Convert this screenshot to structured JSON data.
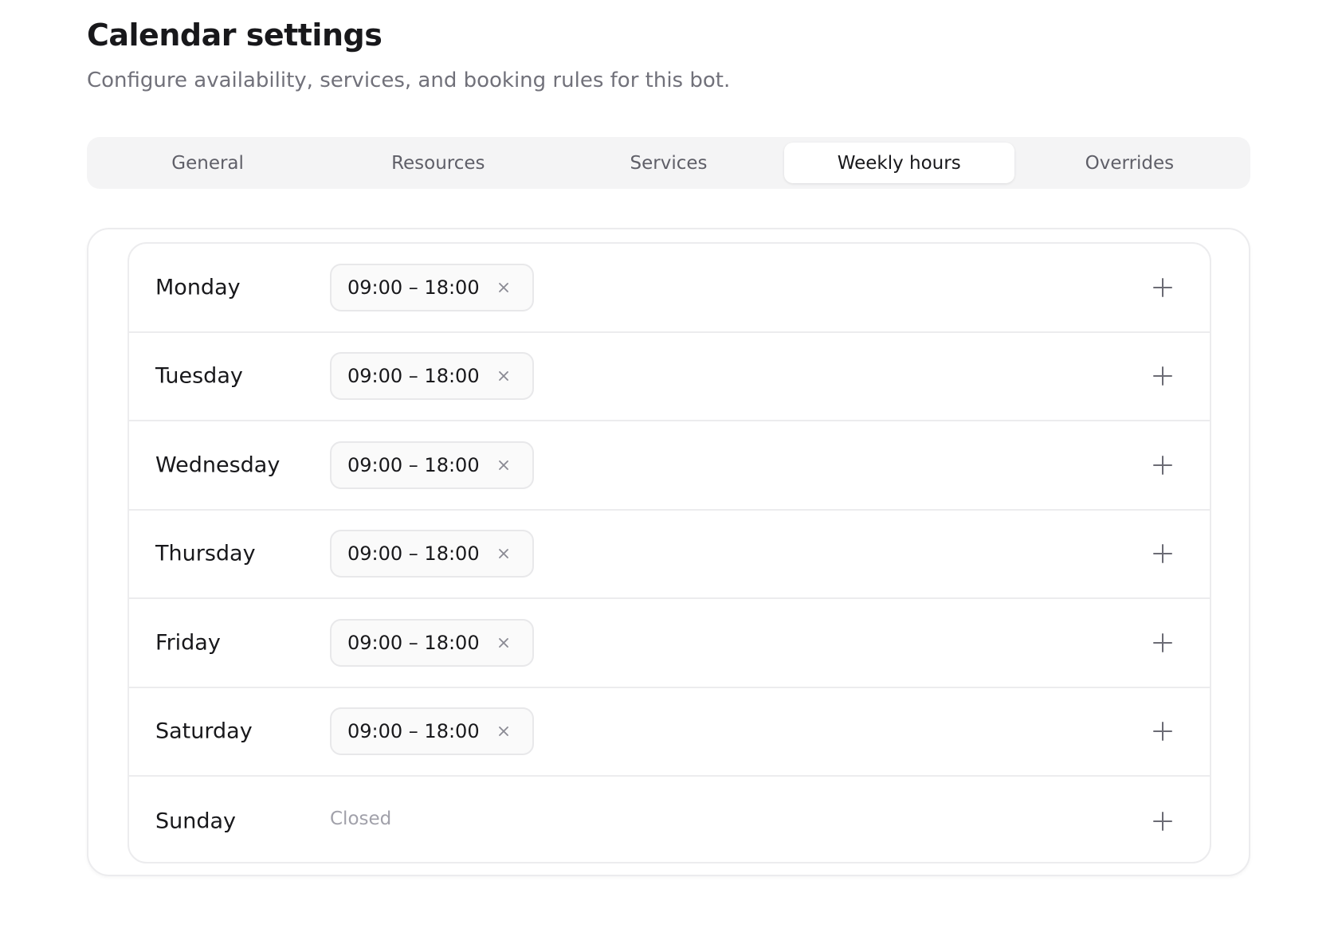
{
  "header": {
    "title": "Calendar settings",
    "subtitle": "Configure availability, services, and booking rules for this bot."
  },
  "tabs": [
    {
      "label": "General",
      "active": false
    },
    {
      "label": "Resources",
      "active": false
    },
    {
      "label": "Services",
      "active": false
    },
    {
      "label": "Weekly hours",
      "active": true
    },
    {
      "label": "Overrides",
      "active": false
    }
  ],
  "weekly_hours": {
    "days": [
      {
        "name": "Monday",
        "slot": "09:00 – 18:00"
      },
      {
        "name": "Tuesday",
        "slot": "09:00 – 18:00"
      },
      {
        "name": "Wednesday",
        "slot": "09:00 – 18:00"
      },
      {
        "name": "Thursday",
        "slot": "09:00 – 18:00"
      },
      {
        "name": "Friday",
        "slot": "09:00 – 18:00"
      },
      {
        "name": "Saturday",
        "slot": "09:00 – 18:00"
      },
      {
        "name": "Sunday",
        "closed_label": "Closed"
      }
    ]
  },
  "icons": {
    "remove": "close-icon",
    "add": "plus-icon"
  },
  "colors": {
    "text_primary": "#18181b",
    "text_muted": "#71717a",
    "tab_bar_bg": "#f4f4f5",
    "border": "#ececee",
    "closed_text": "#a1a1aa"
  }
}
